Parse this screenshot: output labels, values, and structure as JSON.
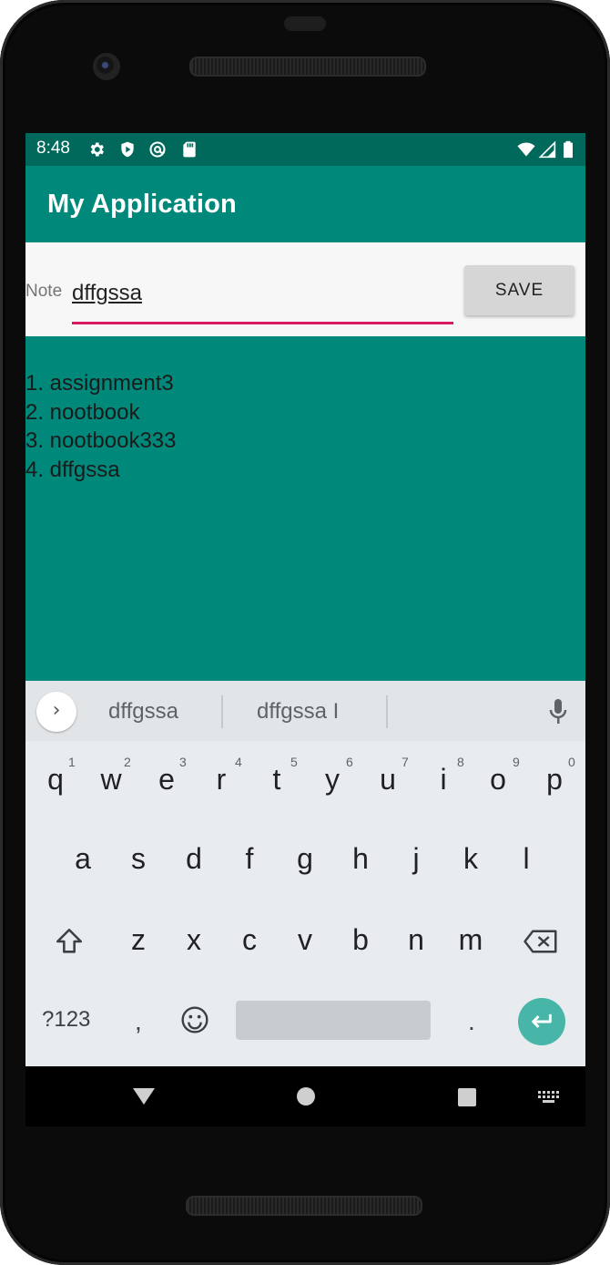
{
  "status_bar": {
    "time": "8:48",
    "left_icons": [
      "settings-icon",
      "shield-icon",
      "at-sign-icon",
      "sd-card-icon"
    ],
    "right_icons": [
      "wifi-icon",
      "cell-signal-icon",
      "battery-icon"
    ]
  },
  "app_bar": {
    "title": "My Application"
  },
  "form": {
    "label": "Note",
    "input_value": "dffgssa",
    "save_label": "SAVE",
    "underline_color": "#d81b60"
  },
  "list": {
    "items": [
      "1. assignment3",
      "2. nootbook",
      "3. nootbook333",
      "4. dffgssa"
    ]
  },
  "keyboard": {
    "suggestions": [
      "dffgssa",
      "dffgssa I"
    ],
    "row1": [
      "q",
      "w",
      "e",
      "r",
      "t",
      "y",
      "u",
      "i",
      "o",
      "p"
    ],
    "row1_hints": [
      "1",
      "2",
      "3",
      "4",
      "5",
      "6",
      "7",
      "8",
      "9",
      "0"
    ],
    "row2": [
      "a",
      "s",
      "d",
      "f",
      "g",
      "h",
      "j",
      "k",
      "l"
    ],
    "row3": [
      "z",
      "x",
      "c",
      "v",
      "b",
      "n",
      "m"
    ],
    "symbols_label": "?123",
    "comma": ",",
    "period": "."
  },
  "colors": {
    "status_bar": "#00695c",
    "app_bar": "#00897b",
    "list_background": "#00897b",
    "enter_key": "#47b6a9"
  }
}
